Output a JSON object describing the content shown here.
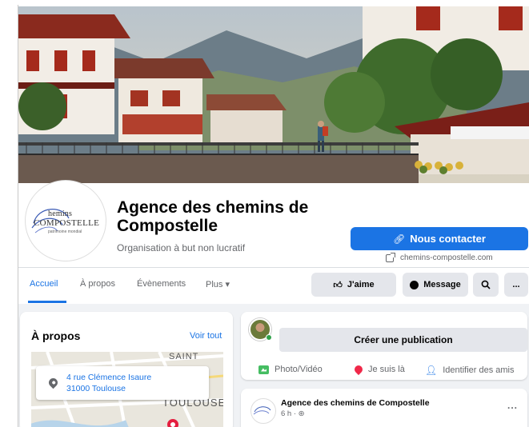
{
  "page": {
    "name": "Agence des chemins de Compostelle",
    "category": "Organisation à but non lucratif",
    "logo_line1": "hemins",
    "logo_line2": "COMPOSTELLE",
    "logo_line3": "patrimoine mondial",
    "contact_button": "Nous contacter",
    "website": "chemins-compostelle.com"
  },
  "nav": {
    "tabs": [
      {
        "label": "Accueil",
        "active": true
      },
      {
        "label": "À propos"
      },
      {
        "label": "Évènements"
      },
      {
        "label": "Plus ▾"
      }
    ],
    "actions": {
      "like": "J'aime",
      "message": "Message",
      "search_icon": "search-icon",
      "more": "..."
    }
  },
  "about": {
    "title": "À propos",
    "see_all": "Voir tout",
    "address_line1": "4 rue Clémence Isaure",
    "address_line2": "31000 Toulouse",
    "map_label_top": "SAINT",
    "map_label_city": "TOULOUSE"
  },
  "composer": {
    "prompt": "Créer une publication",
    "photo_video": "Photo/Vidéo",
    "checkin": "Je suis là",
    "tag_friends": "Identifier des amis"
  },
  "post": {
    "author": "Agence des chemins de Compostelle",
    "meta": "6 h · ⊛"
  },
  "colors": {
    "accent": "#1b74e4",
    "button_gray": "#e4e6eb",
    "feed_bg": "#f0f2f5",
    "online": "#31a24c"
  }
}
